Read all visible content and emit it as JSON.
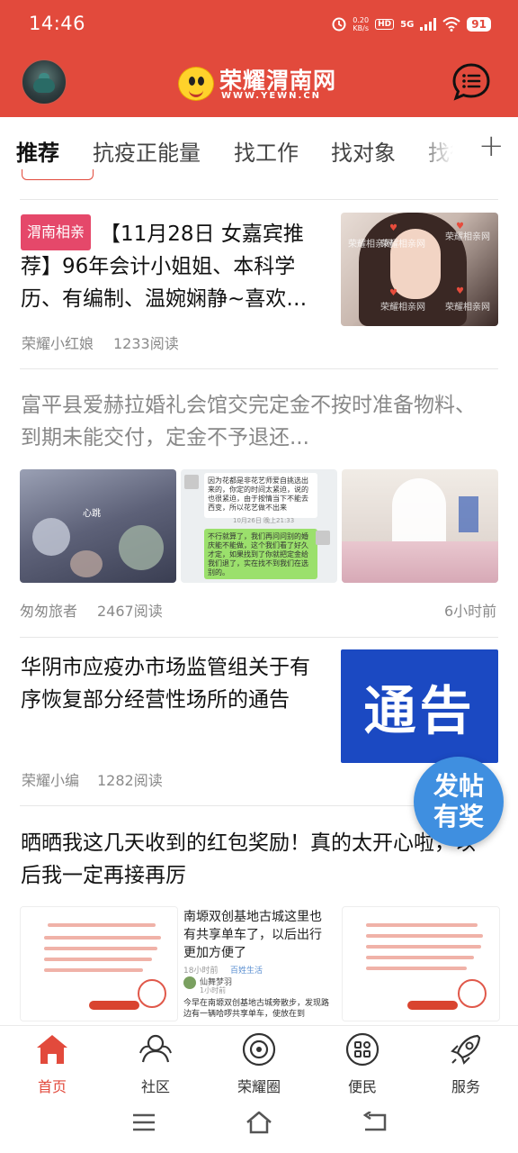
{
  "status_bar": {
    "time": "14:46",
    "net_speed_value": "0.20",
    "net_speed_unit": "KB/s",
    "hd": "HD",
    "network": "5G",
    "battery": "91"
  },
  "header": {
    "logo_title": "荣耀渭南网",
    "logo_sub": "WWW.YEWN.CN",
    "accent_color": "#e24a3c"
  },
  "tabs": [
    {
      "label": "推荐"
    },
    {
      "label": "抗疫正能量"
    },
    {
      "label": "找工作"
    },
    {
      "label": "找对象"
    },
    {
      "label": "找律"
    }
  ],
  "feed": [
    {
      "tag": "渭南相亲",
      "title": "【11月28日 女嘉宾推荐】96年会计小姐姐、本科学历、有编制、温婉娴静~喜欢…",
      "author": "荣耀小红娘",
      "reads": "1233阅读",
      "watermark": "荣耀相亲网"
    },
    {
      "title": "富平县爱赫拉婚礼会馆交完定金不按时准备物料、到期未能交付，定金不予退还...",
      "author": "匆匆旅者",
      "reads": "2467阅读",
      "time": "6小时前",
      "chat_text_1": "因为花都是非花艺师爱自挑选出来的，你定的时间太紧迫，说的也很紧迫，由于按情当下不能去西变，所以花艺做不出来",
      "chat_date": "10月26日 晚上21:33",
      "chat_text_2": "不行就算了，我们再问问别的婚庆能不能做，这个我们看了好久才定，如果找到了你就把定金给我们退了，实在找不到我们在选别的。",
      "img_label": "心跳"
    },
    {
      "title": "华阴市应疫办市场监管组关于有序恢复部分经营性场所的通告",
      "author": "荣耀小编",
      "reads": "1282阅读",
      "notice_text": "通告"
    },
    {
      "title": "晒晒我这几天收到的红包奖励！真的太开心啦，以后我一定再接再厉",
      "mid_text": "南塬双创基地古城这里也有共享单车了，以后出行更加方便了",
      "mid_meta_time": "18小时前",
      "mid_meta_topic": "百姓生活",
      "mid_user": "仙舞梦羽",
      "mid_user_time": "1小时前",
      "mid_body": "今早在南塬双创基地古城旁散步，发现路边有一辆哈啰共享单车，使放在到"
    }
  ],
  "fab": {
    "line1": "发帖",
    "line2": "有奖",
    "color": "#3f8fe0"
  },
  "bottom_nav": [
    {
      "label": "首页",
      "icon": "home-icon",
      "active": true
    },
    {
      "label": "社区",
      "icon": "community-icon",
      "active": false
    },
    {
      "label": "荣耀圈",
      "icon": "circle-icon",
      "active": false
    },
    {
      "label": "便民",
      "icon": "services-grid-icon",
      "active": false
    },
    {
      "label": "服务",
      "icon": "rocket-icon",
      "active": false
    }
  ]
}
